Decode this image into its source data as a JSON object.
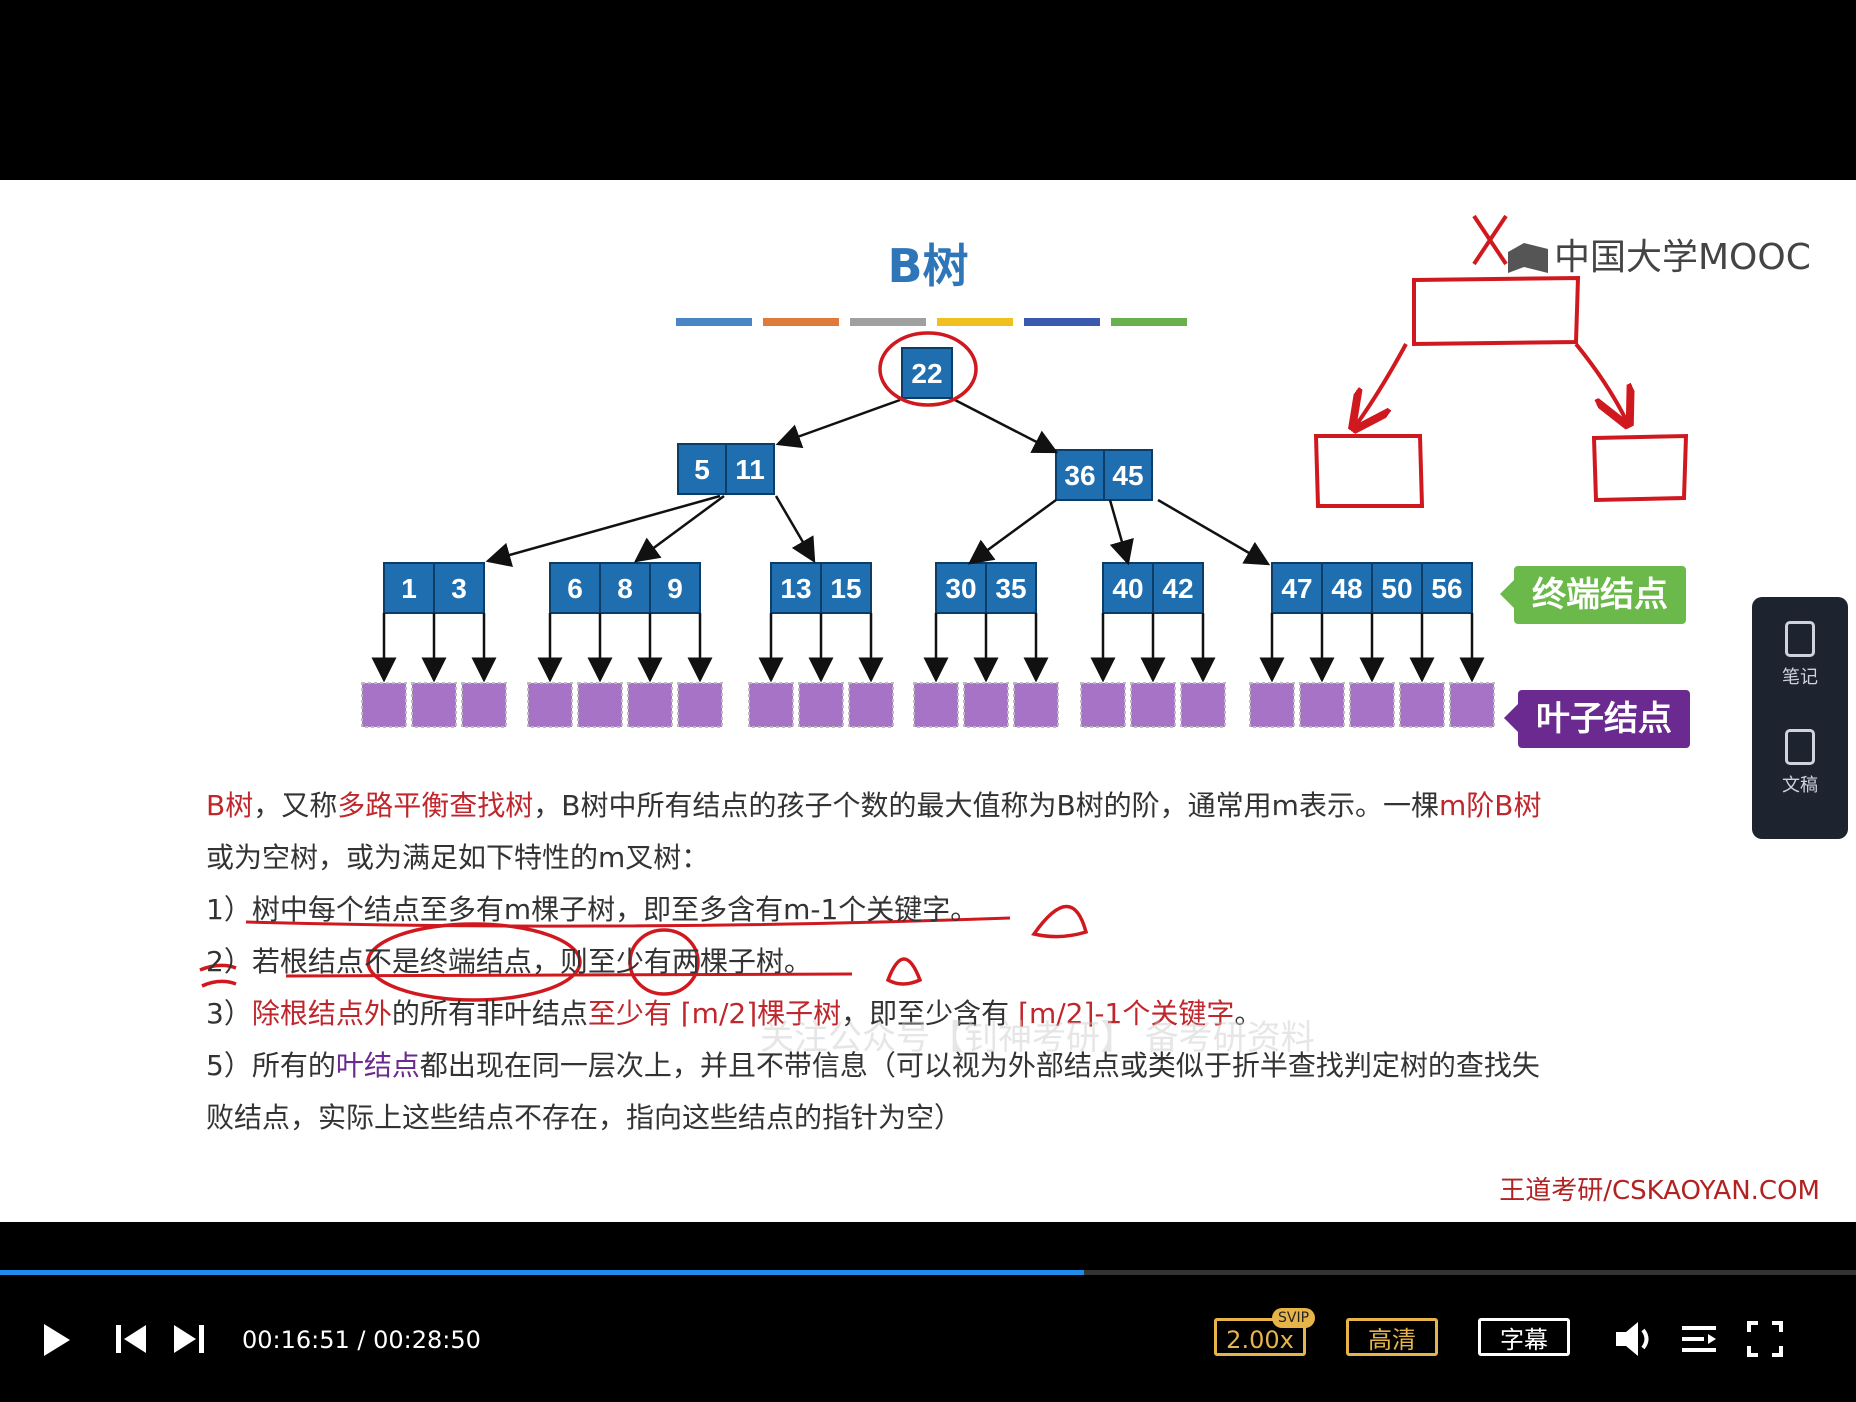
{
  "slide": {
    "title": "B树",
    "logo_text": "中国大学MOOC",
    "color_bars": [
      "#4a86c5",
      "#e07a3a",
      "#a0a0a0",
      "#f0c020",
      "#3a5ab0",
      "#6ab04c"
    ],
    "tree": {
      "root": [
        "22"
      ],
      "level1": [
        [
          "5",
          "11"
        ],
        [
          "36",
          "45"
        ]
      ],
      "level2": [
        [
          "1",
          "3"
        ],
        [
          "6",
          "8",
          "9"
        ],
        [
          "13",
          "15"
        ],
        [
          "30",
          "35"
        ],
        [
          "40",
          "42"
        ],
        [
          "47",
          "48",
          "50",
          "56"
        ]
      ]
    },
    "tag_terminal": "终端结点",
    "tag_leaf": "叶子结点",
    "paragraph": {
      "p1_a": "B树",
      "p1_b": "，又称",
      "p1_c": "多路平衡查找树",
      "p1_d": "，B树中所有结点的孩子个数的最大值称为B树的阶，通常用m表示。一棵",
      "p1_e": "m阶B树",
      "p2": "或为空树，或为满足如下特性的m叉树：",
      "item1": "1）树中每个结点至多有m棵子树，即至多含有m-1个关键字。",
      "item2": "2）若根结点不是终端结点，则至少有两棵子树。",
      "item3_a": "3）",
      "item3_b": "除根结点外",
      "item3_c": "的所有非叶结点",
      "item3_d": "至少有 ⌈m/2⌉棵子树",
      "item3_e": "，即至少含有 ",
      "item3_f": "⌈m/2⌉-1个关键字",
      "item3_g": "。",
      "item5_a": "5）所有的",
      "item5_b": "叶结点",
      "item5_c": "都出现在同一层次上，并且不带信息（可以视为外部结点或类似于折半查找判定树的查找失",
      "item5_d": "败结点，实际上这些结点不存在，指向这些结点的指针为空）"
    },
    "watermark": "关注公众号【钊神考研】 备考研资料",
    "credit": "王道考研/CSKAOYAN.COM"
  },
  "side_panel": {
    "notes_label": "笔记",
    "doc_label": "文稿"
  },
  "player": {
    "current_time": "00:16:51",
    "total_time": "00:28:50",
    "time_text": "00:16:51 / 00:28:50",
    "progress": 0.584,
    "speed": "2.00x",
    "svip": "SVIP",
    "quality": "高清",
    "subtitle": "字幕"
  }
}
